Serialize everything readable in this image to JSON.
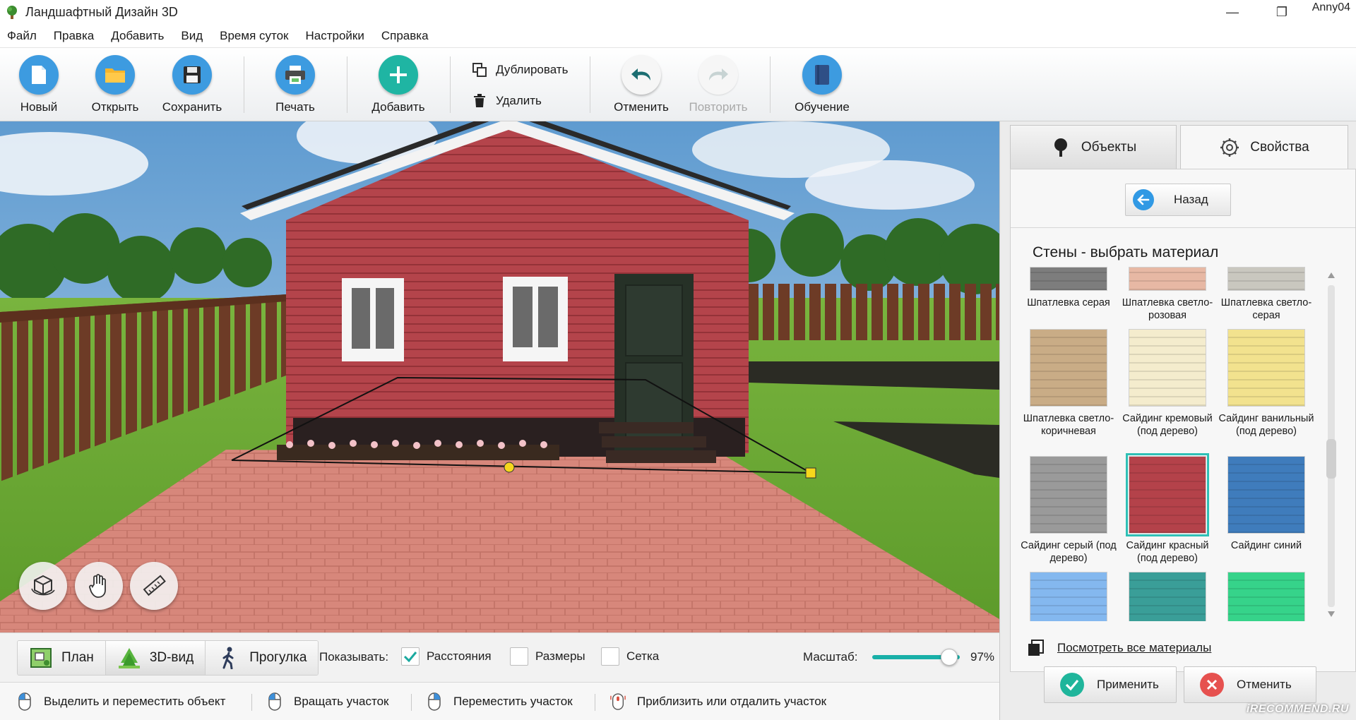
{
  "window": {
    "title": "Ландшафтный Дизайн 3D",
    "user": "Anny04",
    "minimize": "—",
    "restore": "❐"
  },
  "menu": [
    "Файл",
    "Правка",
    "Добавить",
    "Вид",
    "Время суток",
    "Настройки",
    "Справка"
  ],
  "toolbar": {
    "new": "Новый",
    "open": "Открыть",
    "save": "Сохранить",
    "print": "Печать",
    "add": "Добавить",
    "duplicate": "Дублировать",
    "delete": "Удалить",
    "undo": "Отменить",
    "redo": "Повторить",
    "tutorial": "Обучение"
  },
  "view_modes": {
    "plan": "План",
    "view3d": "3D-вид",
    "walk": "Прогулка",
    "active": "3D-вид"
  },
  "show_options": {
    "label": "Показывать:",
    "distances": {
      "label": "Расстояния",
      "checked": true
    },
    "sizes": {
      "label": "Размеры",
      "checked": false
    },
    "grid": {
      "label": "Сетка",
      "checked": false
    }
  },
  "scale": {
    "label": "Масштаб:",
    "value_text": "97%",
    "value": 0.97
  },
  "status_hints": [
    "Выделить и переместить объект",
    "Вращать участок",
    "Переместить участок",
    "Приблизить или отдалить участок"
  ],
  "panel": {
    "tab_objects": "Объекты",
    "tab_properties": "Свойства",
    "active_tab": "Свойства",
    "back": "Назад",
    "section_title": "Стены - выбрать материал",
    "materials": [
      {
        "name": "Шпатлевка серая",
        "color": "#7d7d7d"
      },
      {
        "name": "Шпатлевка светло-розовая",
        "color": "#e7b8a4"
      },
      {
        "name": "Шпатлевка светло-серая",
        "color": "#c9c7bf"
      },
      {
        "name": "Шпатлевка светло-коричневая",
        "color": "#c9ac86"
      },
      {
        "name": "Сайдинг кремовый (под дерево)",
        "color": "#f4eccd"
      },
      {
        "name": "Сайдинг ванильный (под дерево)",
        "color": "#f2e28e"
      },
      {
        "name": "Сайдинг серый (под дерево)",
        "color": "#9a9a9a"
      },
      {
        "name": "Сайдинг красный (под дерево)",
        "color": "#b4424a",
        "selected": true
      },
      {
        "name": "Сайдинг синий",
        "color": "#3f7cbc"
      },
      {
        "name": "",
        "color": "#84b8ef"
      },
      {
        "name": "",
        "color": "#3a9e98"
      },
      {
        "name": "",
        "color": "#36d38a"
      }
    ],
    "all_materials_link": "Посмотреть все материалы",
    "apply": "Применить",
    "cancel": "Отменить"
  },
  "watermark": "iRECOMMEND.RU"
}
